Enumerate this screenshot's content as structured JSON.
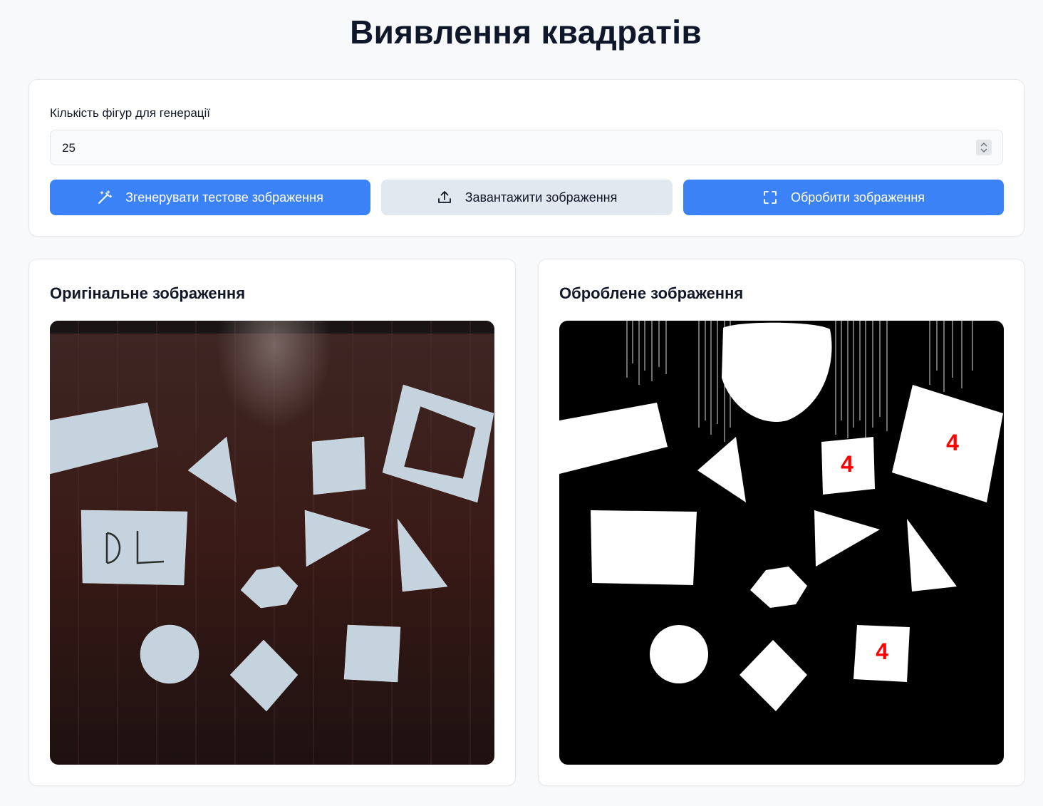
{
  "page": {
    "title": "Виявлення квадратів"
  },
  "controls": {
    "count_label": "Кількість фігур для генерації",
    "count_value": "25",
    "generate_button": "Згенерувати тестове зображення",
    "upload_button": "Завантажити зображення",
    "process_button": "Обробити зображення"
  },
  "panels": {
    "original_title": "Оригінальне зображення",
    "processed_title": "Оброблене зображення"
  },
  "processed_labels": [
    "4",
    "4",
    "4"
  ],
  "colors": {
    "primary": "#3b82f6",
    "secondary": "#e2e8f0",
    "label_red": "#ff0000",
    "wood": "#3b1b16",
    "paper": "#c5d3de"
  }
}
